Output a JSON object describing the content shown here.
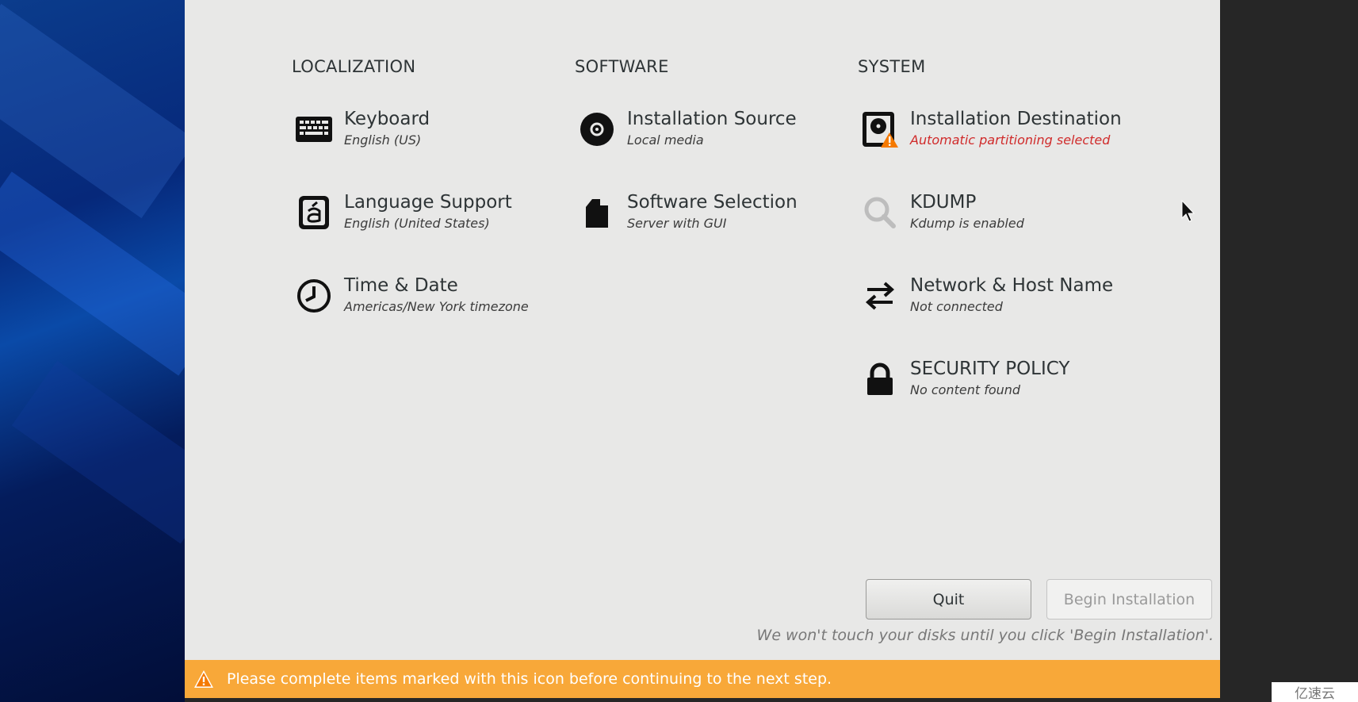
{
  "sections": {
    "localization": "LOCALIZATION",
    "software": "SOFTWARE",
    "system": "SYSTEM"
  },
  "items": {
    "keyboard": {
      "title": "Keyboard",
      "status": "English (US)",
      "icon": "keyboard-icon"
    },
    "language": {
      "title": "Language Support",
      "status": "English (United States)",
      "icon": "language-icon"
    },
    "time": {
      "title": "Time & Date",
      "status": "Americas/New York timezone",
      "icon": "clock-icon"
    },
    "source": {
      "title": "Installation Source",
      "status": "Local media",
      "icon": "disc-icon"
    },
    "selection": {
      "title": "Software Selection",
      "status": "Server with GUI",
      "icon": "package-icon"
    },
    "destination": {
      "title": "Installation Destination",
      "status": "Automatic partitioning selected",
      "icon": "harddisk-warning-icon",
      "warning": true
    },
    "kdump": {
      "title": "KDUMP",
      "status": "Kdump is enabled",
      "icon": "search-icon"
    },
    "network": {
      "title": "Network & Host Name",
      "status": "Not connected",
      "icon": "network-arrows-icon"
    },
    "security": {
      "title": "SECURITY POLICY",
      "status": "No content found",
      "icon": "lock-icon"
    }
  },
  "buttons": {
    "quit": "Quit",
    "begin": "Begin Installation"
  },
  "note": "We won't touch your disks until you click 'Begin Installation'.",
  "warning_bar": {
    "text": "Please complete items marked with this icon before continuing to the next step.",
    "icon": "warning-icon"
  },
  "watermark": "亿速云",
  "colors": {
    "warning_bar": "#f8a839",
    "warning_text": "#d02b2b",
    "background": "#e8e8e7"
  }
}
